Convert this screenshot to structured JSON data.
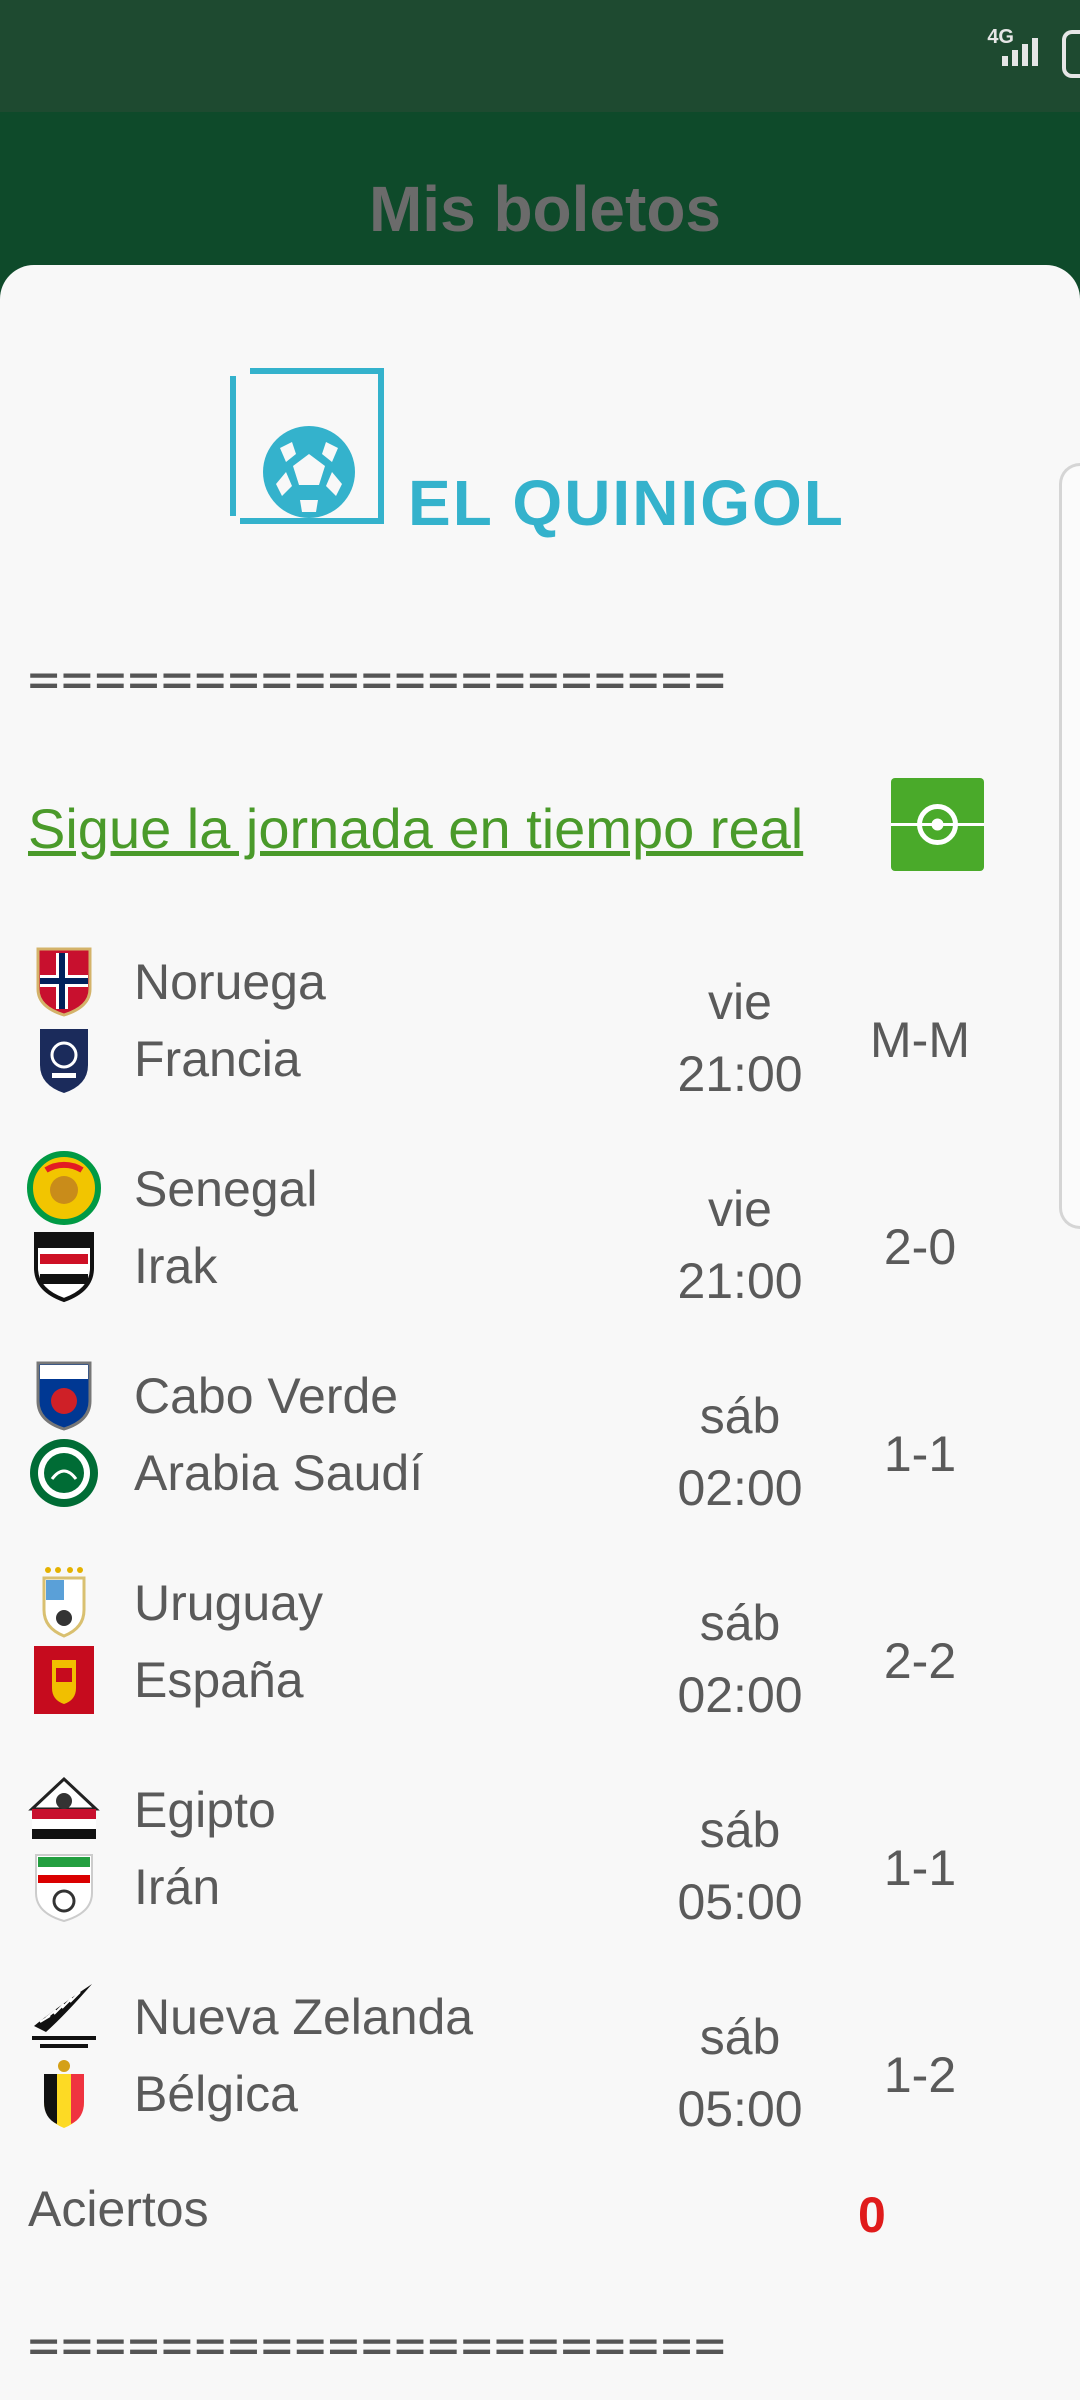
{
  "status_bar": {
    "network": "4G"
  },
  "app_bar": {
    "title": "Mis boletos"
  },
  "ticket": {
    "brand": "EL QUINIGOL",
    "separator": "=====================",
    "live_link": "Sigue la jornada en tiempo real",
    "matches": [
      {
        "home": "Noruega",
        "away": "Francia",
        "day": "vie",
        "time": "21:00",
        "result": "M-M"
      },
      {
        "home": "Senegal",
        "away": "Irak",
        "day": "vie",
        "time": "21:00",
        "result": "2-0"
      },
      {
        "home": "Cabo Verde",
        "away": "Arabia Saudí",
        "day": "sáb",
        "time": "02:00",
        "result": "1-1"
      },
      {
        "home": "Uruguay",
        "away": "España",
        "day": "sáb",
        "time": "02:00",
        "result": "2-2"
      },
      {
        "home": "Egipto",
        "away": "Irán",
        "day": "sáb",
        "time": "05:00",
        "result": "1-1"
      },
      {
        "home": "Nueva Zelanda",
        "away": "Bélgica",
        "day": "sáb",
        "time": "05:00",
        "result": "1-2"
      }
    ],
    "aciertos_label": "Aciertos",
    "aciertos_value": "0"
  },
  "colors": {
    "brand": "#34b2cc",
    "link": "#4a9a2a",
    "accent_red": "#e01b1b"
  }
}
